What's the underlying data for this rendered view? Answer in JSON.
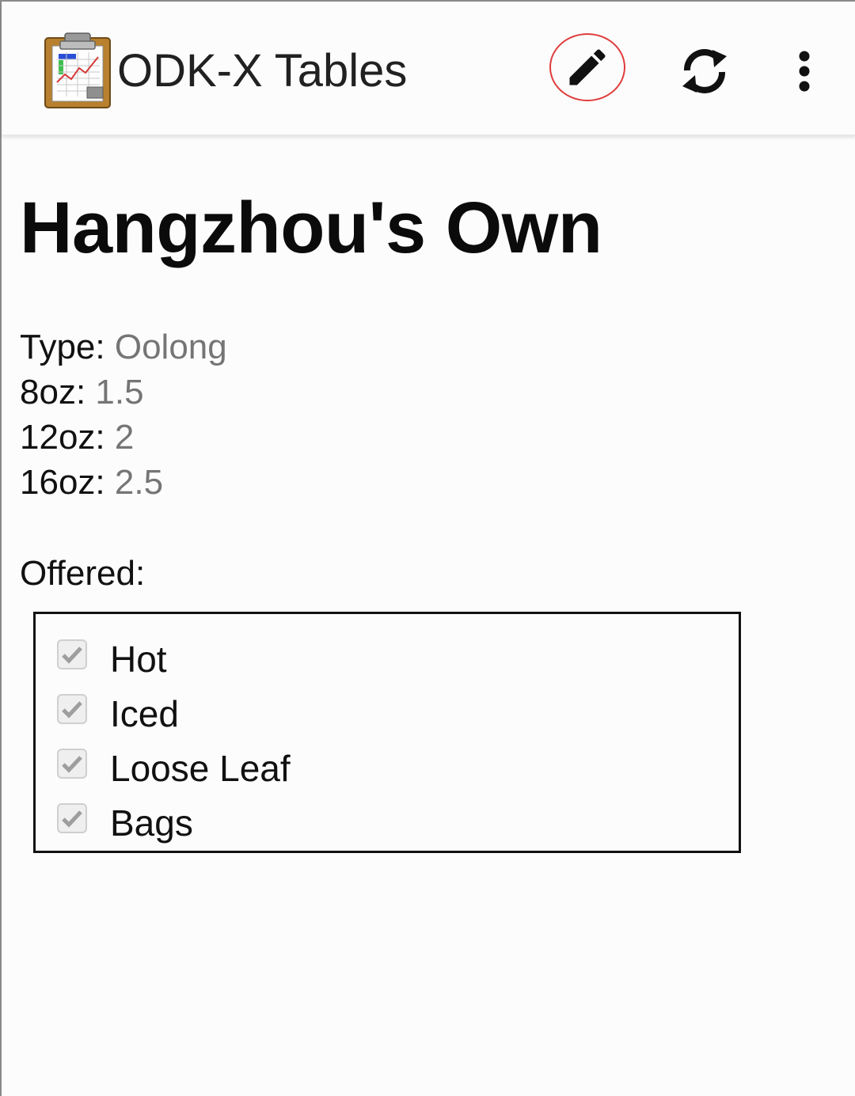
{
  "appbar": {
    "title": "ODK-X Tables",
    "logo_icon": "clipboard-chart-icon",
    "actions": [
      {
        "name": "edit",
        "icon": "pencil-icon"
      },
      {
        "name": "sync",
        "icon": "sync-icon"
      },
      {
        "name": "more",
        "icon": "more-vert-icon"
      }
    ],
    "highlight_color": "#e03c3c"
  },
  "record": {
    "name": "Hangzhou's Own",
    "fields": [
      {
        "label": "Type:",
        "value": "Oolong"
      },
      {
        "label": "8oz:",
        "value": "1.5"
      },
      {
        "label": "12oz:",
        "value": "2"
      },
      {
        "label": "16oz:",
        "value": "2.5"
      }
    ],
    "offered_label": "Offered:",
    "offered_options": [
      {
        "label": "Hot",
        "checked": true
      },
      {
        "label": "Iced",
        "checked": true
      },
      {
        "label": "Loose Leaf",
        "checked": true
      },
      {
        "label": "Bags",
        "checked": true
      }
    ]
  },
  "colors": {
    "value_text": "#757575",
    "checkbox_disabled": "#9e9e9e"
  }
}
